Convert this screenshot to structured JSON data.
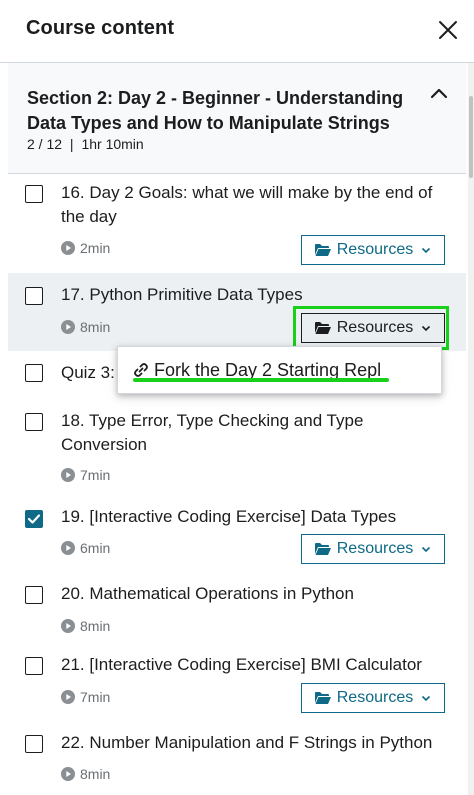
{
  "header": {
    "title": "Course content"
  },
  "section": {
    "title": "Section 2: Day 2 - Beginner - Understanding Data Types and How to Manipulate Strings",
    "progress": "2 / 12",
    "separator": "|",
    "duration": "1hr 10min"
  },
  "resources_label": "Resources",
  "items": [
    {
      "title": "16. Day 2 Goals: what we will make by the end of the day",
      "duration": "2min",
      "checked": false
    },
    {
      "title": "17. Python Primitive Data Types",
      "duration": "8min",
      "checked": false
    },
    {
      "title": "Quiz 3: ",
      "duration": "",
      "checked": false
    },
    {
      "title": "18. Type Error, Type Checking and Type Conversion",
      "duration": "7min",
      "checked": false
    },
    {
      "title": "19. [Interactive Coding Exercise] Data Types",
      "duration": "6min",
      "checked": true
    },
    {
      "title": "20. Mathematical Operations in Python",
      "duration": "8min",
      "checked": false
    },
    {
      "title": "21. [Interactive Coding Exercise] BMI Calculator",
      "duration": "7min",
      "checked": false
    },
    {
      "title": "22. Number Manipulation and F Strings in Python",
      "duration": "8min",
      "checked": false
    }
  ],
  "dropdown": {
    "item_label": "Fork the Day 2 Starting Repl"
  },
  "colors": {
    "accent": "#0e6a86",
    "highlight": "#19d11b",
    "active_row": "#edf0f2"
  }
}
